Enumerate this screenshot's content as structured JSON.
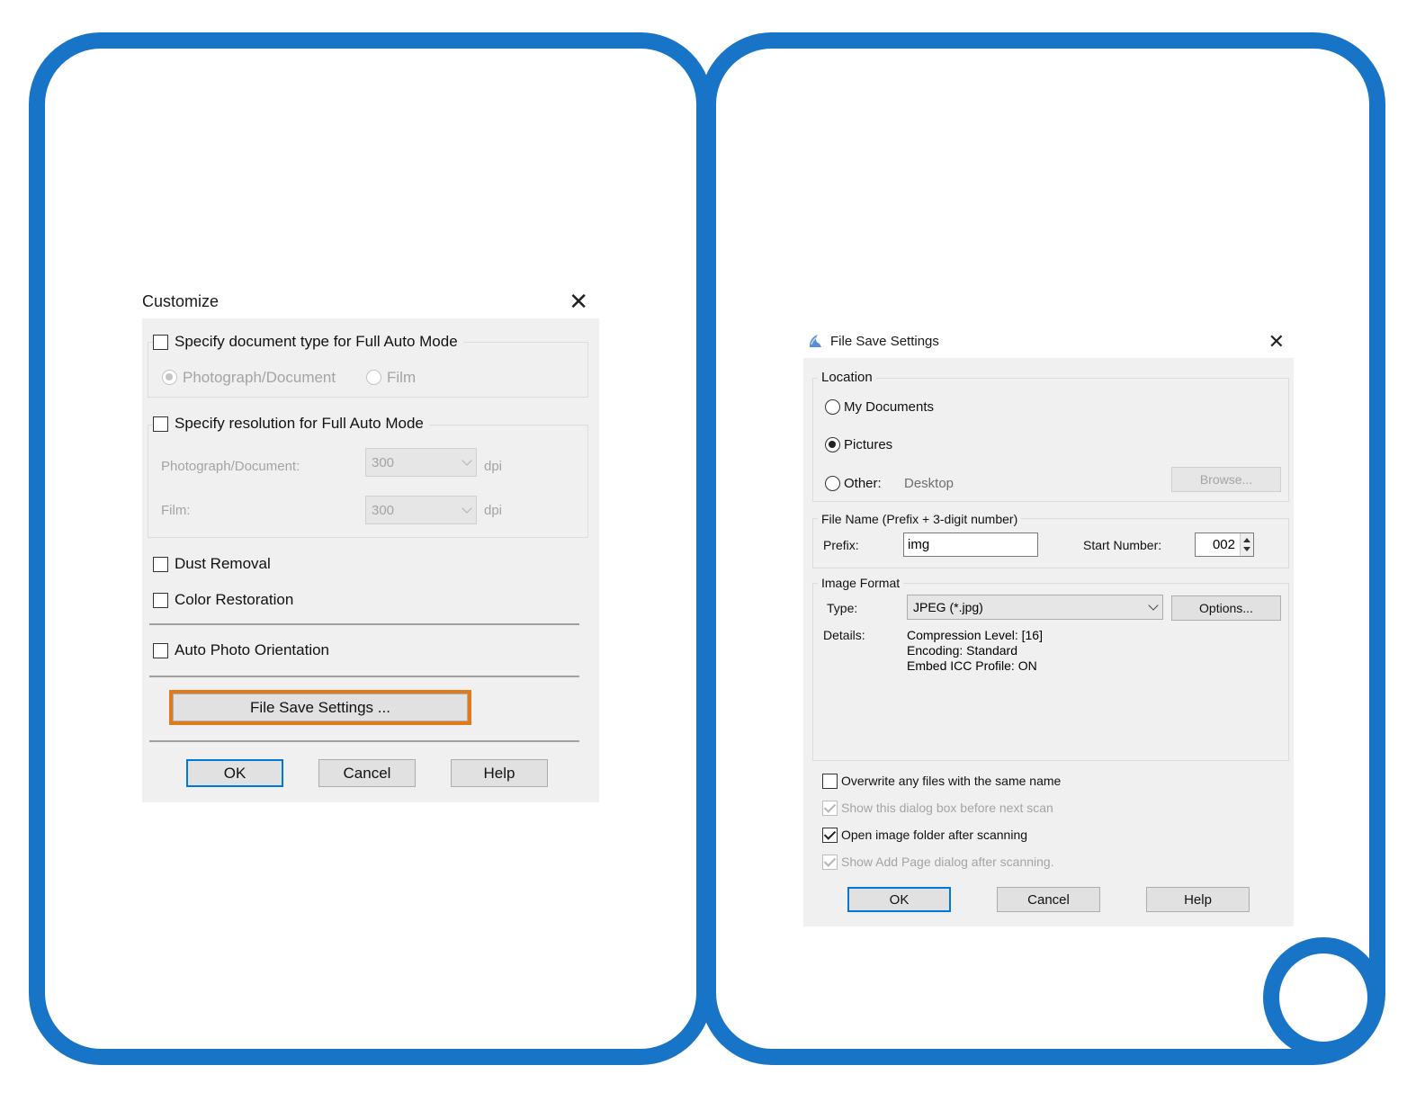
{
  "customize": {
    "title": "Customize",
    "close_glyph": "✕",
    "doc_type_check": "Specify document type for Full Auto Mode",
    "doc_type_options": [
      "Photograph/Document",
      "Film"
    ],
    "resolution_check": "Specify resolution for Full Auto Mode",
    "photo_label": "Photograph/Document:",
    "photo_dpi": "300",
    "film_label": "Film:",
    "film_dpi": "300",
    "dpi_unit": "dpi",
    "dust_removal": "Dust Removal",
    "color_restoration": "Color Restoration",
    "auto_orientation": "Auto Photo Orientation",
    "file_save_button": "File Save Settings ...",
    "ok": "OK",
    "cancel": "Cancel",
    "help": "Help",
    "highlight_color": "#e07a1c"
  },
  "file_save": {
    "title": "File Save Settings",
    "title_icon": "scanner-app-icon",
    "close_glyph": "✕",
    "location_group": "Location",
    "my_documents": "My Documents",
    "pictures": "Pictures",
    "other": "Other:",
    "other_value": "Desktop",
    "browse": "Browse...",
    "filename_group": "File Name (Prefix + 3-digit number)",
    "prefix_label": "Prefix:",
    "prefix_value": "img",
    "start_number_label": "Start Number:",
    "start_number_value": "002",
    "image_format_group": "Image Format",
    "type_label": "Type:",
    "type_value": "JPEG (*.jpg)",
    "options": "Options...",
    "details_label": "Details:",
    "details_lines": [
      "Compression Level: [16]",
      "Encoding: Standard",
      "Embed ICC Profile: ON"
    ],
    "overwrite": "Overwrite any files with the same name",
    "show_dialog": "Show this dialog box before next scan",
    "open_folder": "Open image folder after scanning",
    "show_add_page": "Show Add Page dialog after scanning.",
    "ok": "OK",
    "cancel": "Cancel",
    "help": "Help"
  },
  "colors": {
    "frame_blue": "#1874c6",
    "default_button_border": "#0078d7"
  }
}
